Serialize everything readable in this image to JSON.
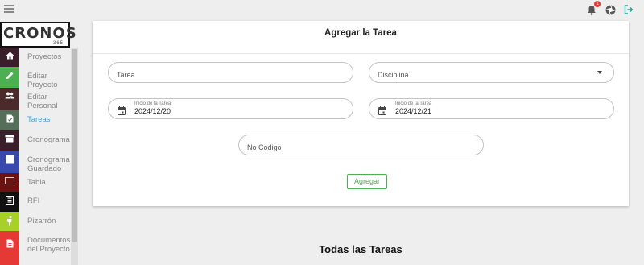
{
  "header": {
    "notification_count": "1",
    "icons": [
      "bell-icon",
      "aperture-icon",
      "logout-icon"
    ]
  },
  "logo": {
    "main": "CRONOS",
    "sub": "365"
  },
  "sidebar": {
    "items": [
      {
        "label": "Proyectos",
        "icon": "home-icon",
        "color": "#3a1f2b"
      },
      {
        "label": "Editar Proyecto",
        "icon": "pencil-icon",
        "color": "#4caf50"
      },
      {
        "label": "Editar Personal",
        "icon": "people-icon",
        "color": "#4a2a2a"
      },
      {
        "label": "Tareas",
        "icon": "document-check-icon",
        "color": "#546e5a",
        "active": true
      },
      {
        "label": "Cronograma",
        "icon": "archive-icon",
        "color": "#3a1f2b"
      },
      {
        "label": "Cronograma Guardado",
        "icon": "storage-icon",
        "color": "#3949ab"
      },
      {
        "label": "Tabla",
        "icon": "table-icon",
        "color": "#6d1111"
      },
      {
        "label": "RFI",
        "icon": "list-icon",
        "color": "#111111"
      },
      {
        "label": "Pizarrón",
        "icon": "person-icon",
        "color": "#a7d129"
      },
      {
        "label": "Documentos del Proyecto",
        "icon": "file-icon",
        "color": "#e53935"
      }
    ]
  },
  "form": {
    "title": "Agregar la Tarea",
    "tarea_placeholder": "Tarea",
    "disciplina_placeholder": "Disciplina",
    "start_label": "Inicio de la Tarea",
    "start_value": "2024/12/20",
    "end_label": "Inicio de la Tarea",
    "end_value": "2024/12/21",
    "codigo_placeholder": "No Codigo",
    "submit_label": "Agregar"
  },
  "section": {
    "title": "Todas las Tareas"
  },
  "colors": {
    "accent": "#4caf50",
    "active_link": "#4a9fd8",
    "badge": "#e53935"
  }
}
